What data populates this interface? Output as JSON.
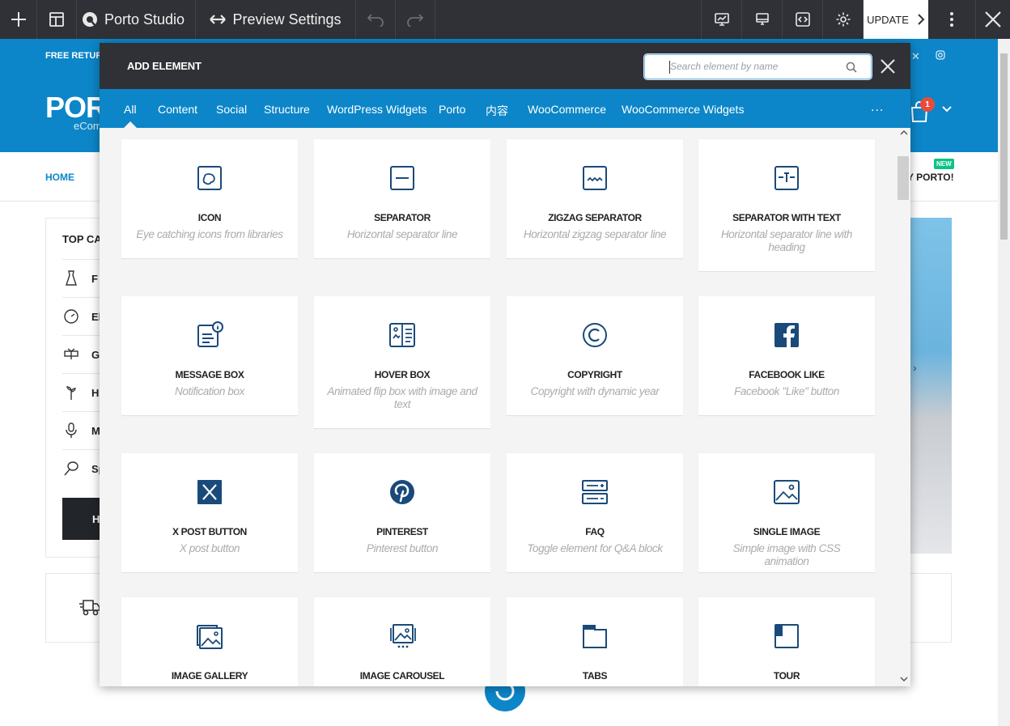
{
  "toolbar": {
    "studio_label": "Porto Studio",
    "preview_label": "Preview Settings",
    "update_label": "UPDATE"
  },
  "site": {
    "promo": "FREE RETURN",
    "logo": "PORT",
    "logo_sub": "eCom",
    "nav_home": "HOME",
    "nav_porto": "Y PORTO!",
    "new_badge": "NEW",
    "cart_count": "1",
    "categories_title": "TOP CA",
    "categories": [
      {
        "icon": "dress-icon",
        "label": "F"
      },
      {
        "icon": "gauge-icon",
        "label": "El"
      },
      {
        "icon": "gift-icon",
        "label": "G"
      },
      {
        "icon": "plant-icon",
        "label": "H"
      },
      {
        "icon": "microphone-icon",
        "label": "M"
      },
      {
        "icon": "racket-icon",
        "label": "Sp"
      }
    ],
    "dark_button": "H"
  },
  "panel": {
    "title": "ADD ELEMENT",
    "search_placeholder": "Search element by name",
    "tabs": [
      "All",
      "Content",
      "Social",
      "Structure",
      "WordPress Widgets",
      "Porto",
      "内容",
      "WooCommerce",
      "WooCommerce Widgets"
    ],
    "active_tab": "All",
    "more": "...",
    "elements": [
      {
        "icon": "icon-element-icon",
        "name": "ICON",
        "desc": "Eye catching icons from libraries"
      },
      {
        "icon": "separator-icon",
        "name": "SEPARATOR",
        "desc": "Horizontal separator line"
      },
      {
        "icon": "zigzag-separator-icon",
        "name": "ZIGZAG SEPARATOR",
        "desc": "Horizontal zigzag separator line"
      },
      {
        "icon": "separator-text-icon",
        "name": "SEPARATOR WITH TEXT",
        "desc": "Horizontal separator line with heading"
      },
      {
        "icon": "message-box-icon",
        "name": "MESSAGE BOX",
        "desc": "Notification box"
      },
      {
        "icon": "hover-box-icon",
        "name": "HOVER BOX",
        "desc": "Animated flip box with image and text"
      },
      {
        "icon": "copyright-icon",
        "name": "COPYRIGHT",
        "desc": "Copyright with dynamic year"
      },
      {
        "icon": "facebook-icon",
        "name": "FACEBOOK LIKE",
        "desc": "Facebook \"Like\" button"
      },
      {
        "icon": "x-icon",
        "name": "X POST BUTTON",
        "desc": "X post button"
      },
      {
        "icon": "pinterest-icon",
        "name": "PINTEREST",
        "desc": "Pinterest button"
      },
      {
        "icon": "faq-icon",
        "name": "FAQ",
        "desc": "Toggle element for Q&A block"
      },
      {
        "icon": "single-image-icon",
        "name": "SINGLE IMAGE",
        "desc": "Simple image with CSS animation"
      },
      {
        "icon": "image-gallery-icon",
        "name": "IMAGE GALLERY",
        "desc": ""
      },
      {
        "icon": "image-carousel-icon",
        "name": "IMAGE CAROUSEL",
        "desc": ""
      },
      {
        "icon": "tabs-icon",
        "name": "TABS",
        "desc": ""
      },
      {
        "icon": "tour-icon",
        "name": "TOUR",
        "desc": ""
      }
    ]
  },
  "colors": {
    "toolbar_bg": "#2f3136",
    "brand_blue": "#0c86c8",
    "icon_navy": "#1a4a7a",
    "desc_gray": "#a9abae"
  }
}
